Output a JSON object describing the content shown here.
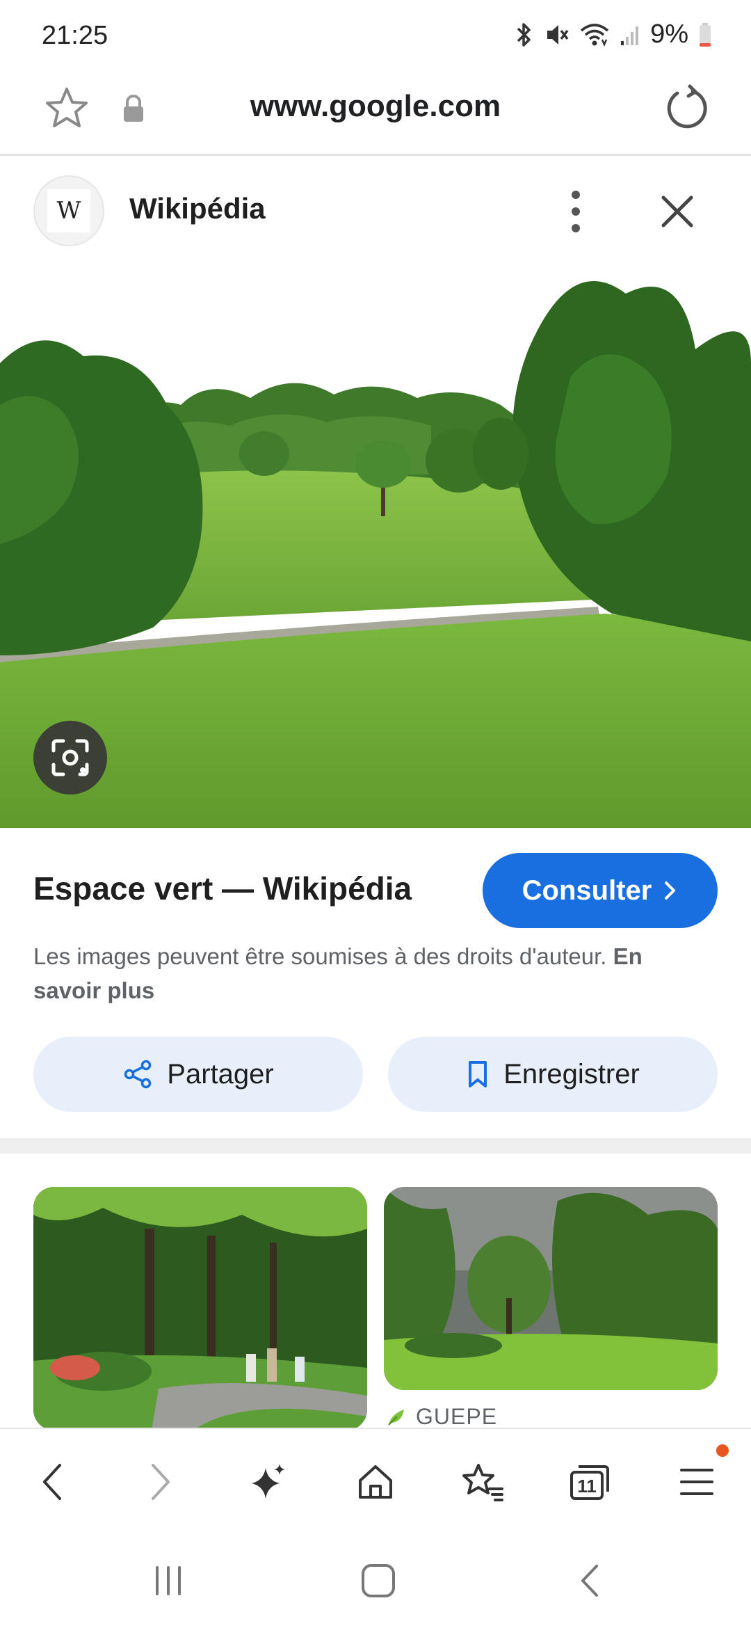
{
  "status_bar": {
    "time": "21:25",
    "battery": "9%",
    "icons": [
      "bluetooth-icon",
      "mute-icon",
      "wifi-icon",
      "signal-icon",
      "battery-icon"
    ]
  },
  "url_bar": {
    "url": "www.google.com"
  },
  "panel": {
    "source_name": "Wikipédia",
    "source_logo_letter": "W"
  },
  "result": {
    "title": "Espace vert — Wikipédia",
    "consult_label": "Consulter",
    "copyright_text": "Les images peuvent être soumises à des droits d'auteur.",
    "learn_more": "En savoir plus",
    "share_label": "Partager",
    "save_label": "Enregistrer"
  },
  "related": {
    "right_source": "GUEPE"
  },
  "toolbar": {
    "tab_count": "11"
  },
  "colors": {
    "accent": "#1a6fe0",
    "button_bg": "#e7effb",
    "notification_dot": "#e8571e"
  }
}
